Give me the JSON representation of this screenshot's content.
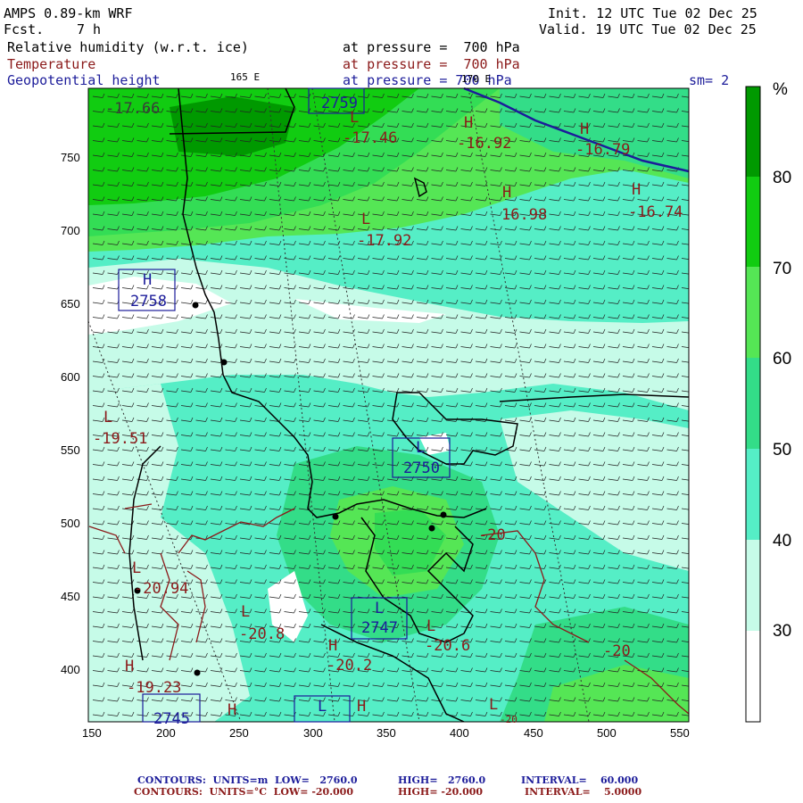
{
  "header": {
    "model": "AMPS 0.89-km WRF",
    "fcst_label": "Fcst.",
    "fcst_value": "7 h",
    "init": "Init. 12 UTC Tue 02 Dec 25",
    "valid": "Valid. 19 UTC Tue 02 Dec 25",
    "field1": "Relative humidity (w.r.t. ice)",
    "field2": "Temperature",
    "field3": "Geopotential height",
    "pressure1": "at pressure =  700 hPa",
    "pressure2": "at pressure =  700 hPa",
    "pressure3": "at pressure = 700 hPa",
    "lon1": "165 E",
    "lon2": "170 E",
    "sm": "sm= 2"
  },
  "colorbar": {
    "unit": "%",
    "labels": [
      "80",
      "70",
      "60",
      "50",
      "40",
      "30"
    ],
    "colors": [
      "#009900",
      "#11cc11",
      "#55e655",
      "#33dd88",
      "#55eec6",
      "#c6fbe8",
      "#ffffff"
    ]
  },
  "axes": {
    "x_ticks": [
      "150",
      "200",
      "250",
      "300",
      "350",
      "400",
      "450",
      "500",
      "550"
    ],
    "y_ticks": [
      "750",
      "700",
      "650",
      "600",
      "550",
      "500",
      "450",
      "400"
    ]
  },
  "map_labels": {
    "h1": "H",
    "h1v": "-16.92",
    "h2": "H",
    "h2v": "-16.79",
    "h3": "H",
    "h3v": "16.98",
    "h4": "H",
    "h4v": "-16.74",
    "l1": "L",
    "l1v": "-17.46",
    "l2": "L",
    "l2v": "-17.92",
    "l3": "L",
    "l3v": "-19.51",
    "l4": "L",
    "l4v": "-20.94",
    "l5": "L",
    "l5v": "-20.8",
    "h5": "H",
    "h5v": "-20.2",
    "l6": "L",
    "l6v": "-20.6",
    "h6": "H",
    "h6v": "-19.23",
    "tl": "-17.66",
    "c20a": "-20",
    "c20b": "-20",
    "box1h": "H",
    "box1v": "2758",
    "box2v": "2759",
    "box3l": "L",
    "box3v": "2750",
    "box4l": "L",
    "box4v": "2747",
    "box5v": "2745",
    "box6l": "L",
    "hbot1": "H",
    "hbot2": "H",
    "lbot": "L",
    "bot26": "-20"
  },
  "footer": {
    "line1_label": "CONTOURS:  UNITS=m  LOW=   2760.0",
    "line1_high": "HIGH=   2760.0",
    "line1_int": "INTERVAL=    60.000",
    "line2_label": "CONTOURS:  UNITS=°C  LOW= -20.000",
    "line2_high": "HIGH= -20.000",
    "line2_int": "INTERVAL=    5.0000"
  }
}
